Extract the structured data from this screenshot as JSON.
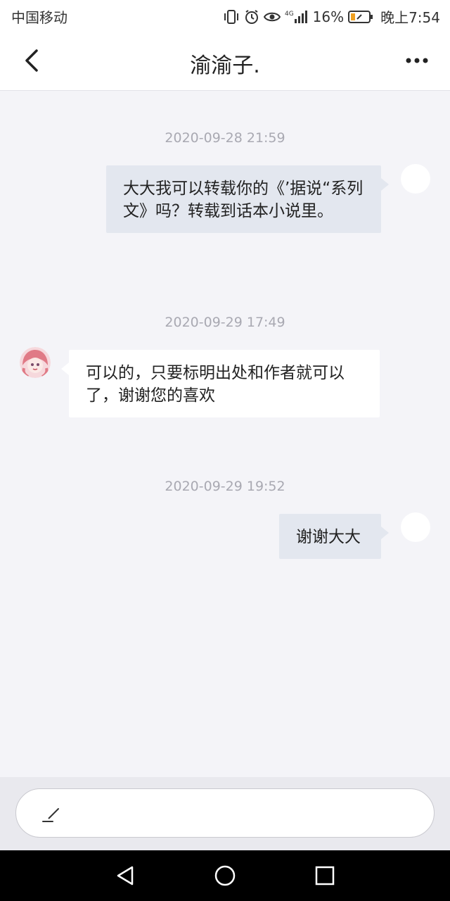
{
  "status_bar": {
    "carrier": "中国移动",
    "network_label": "4G",
    "battery_percent": "16%",
    "time": "晚上7:54",
    "icons": [
      "vibrate-icon",
      "alarm-icon",
      "eye-icon",
      "signal-icon",
      "battery-icon"
    ]
  },
  "header": {
    "title": "渝渝子.",
    "back_icon": "back-chevron-icon",
    "more_icon": "more-dots-icon"
  },
  "messages": [
    {
      "timestamp": "2020-09-28 21:59",
      "direction": "outgoing",
      "text": "大大我可以转载你的《’据说“系列文》吗？转载到话本小说里。"
    },
    {
      "timestamp": "2020-09-29 17:49",
      "direction": "incoming",
      "text": "可以的，只要标明出处和作者就可以了，谢谢您的喜欢"
    },
    {
      "timestamp": "2020-09-29 19:52",
      "direction": "outgoing",
      "text": "谢谢大大"
    }
  ],
  "input": {
    "placeholder": "",
    "icon": "pen-icon"
  },
  "nav_bar": {
    "icons": [
      "nav-back-icon",
      "nav-home-icon",
      "nav-recent-icon"
    ]
  },
  "colors": {
    "background": "#f4f4f8",
    "outgoing_bubble": "#e3e7ef",
    "incoming_bubble": "#ffffff",
    "timestamp_text": "#a9a9b2"
  }
}
